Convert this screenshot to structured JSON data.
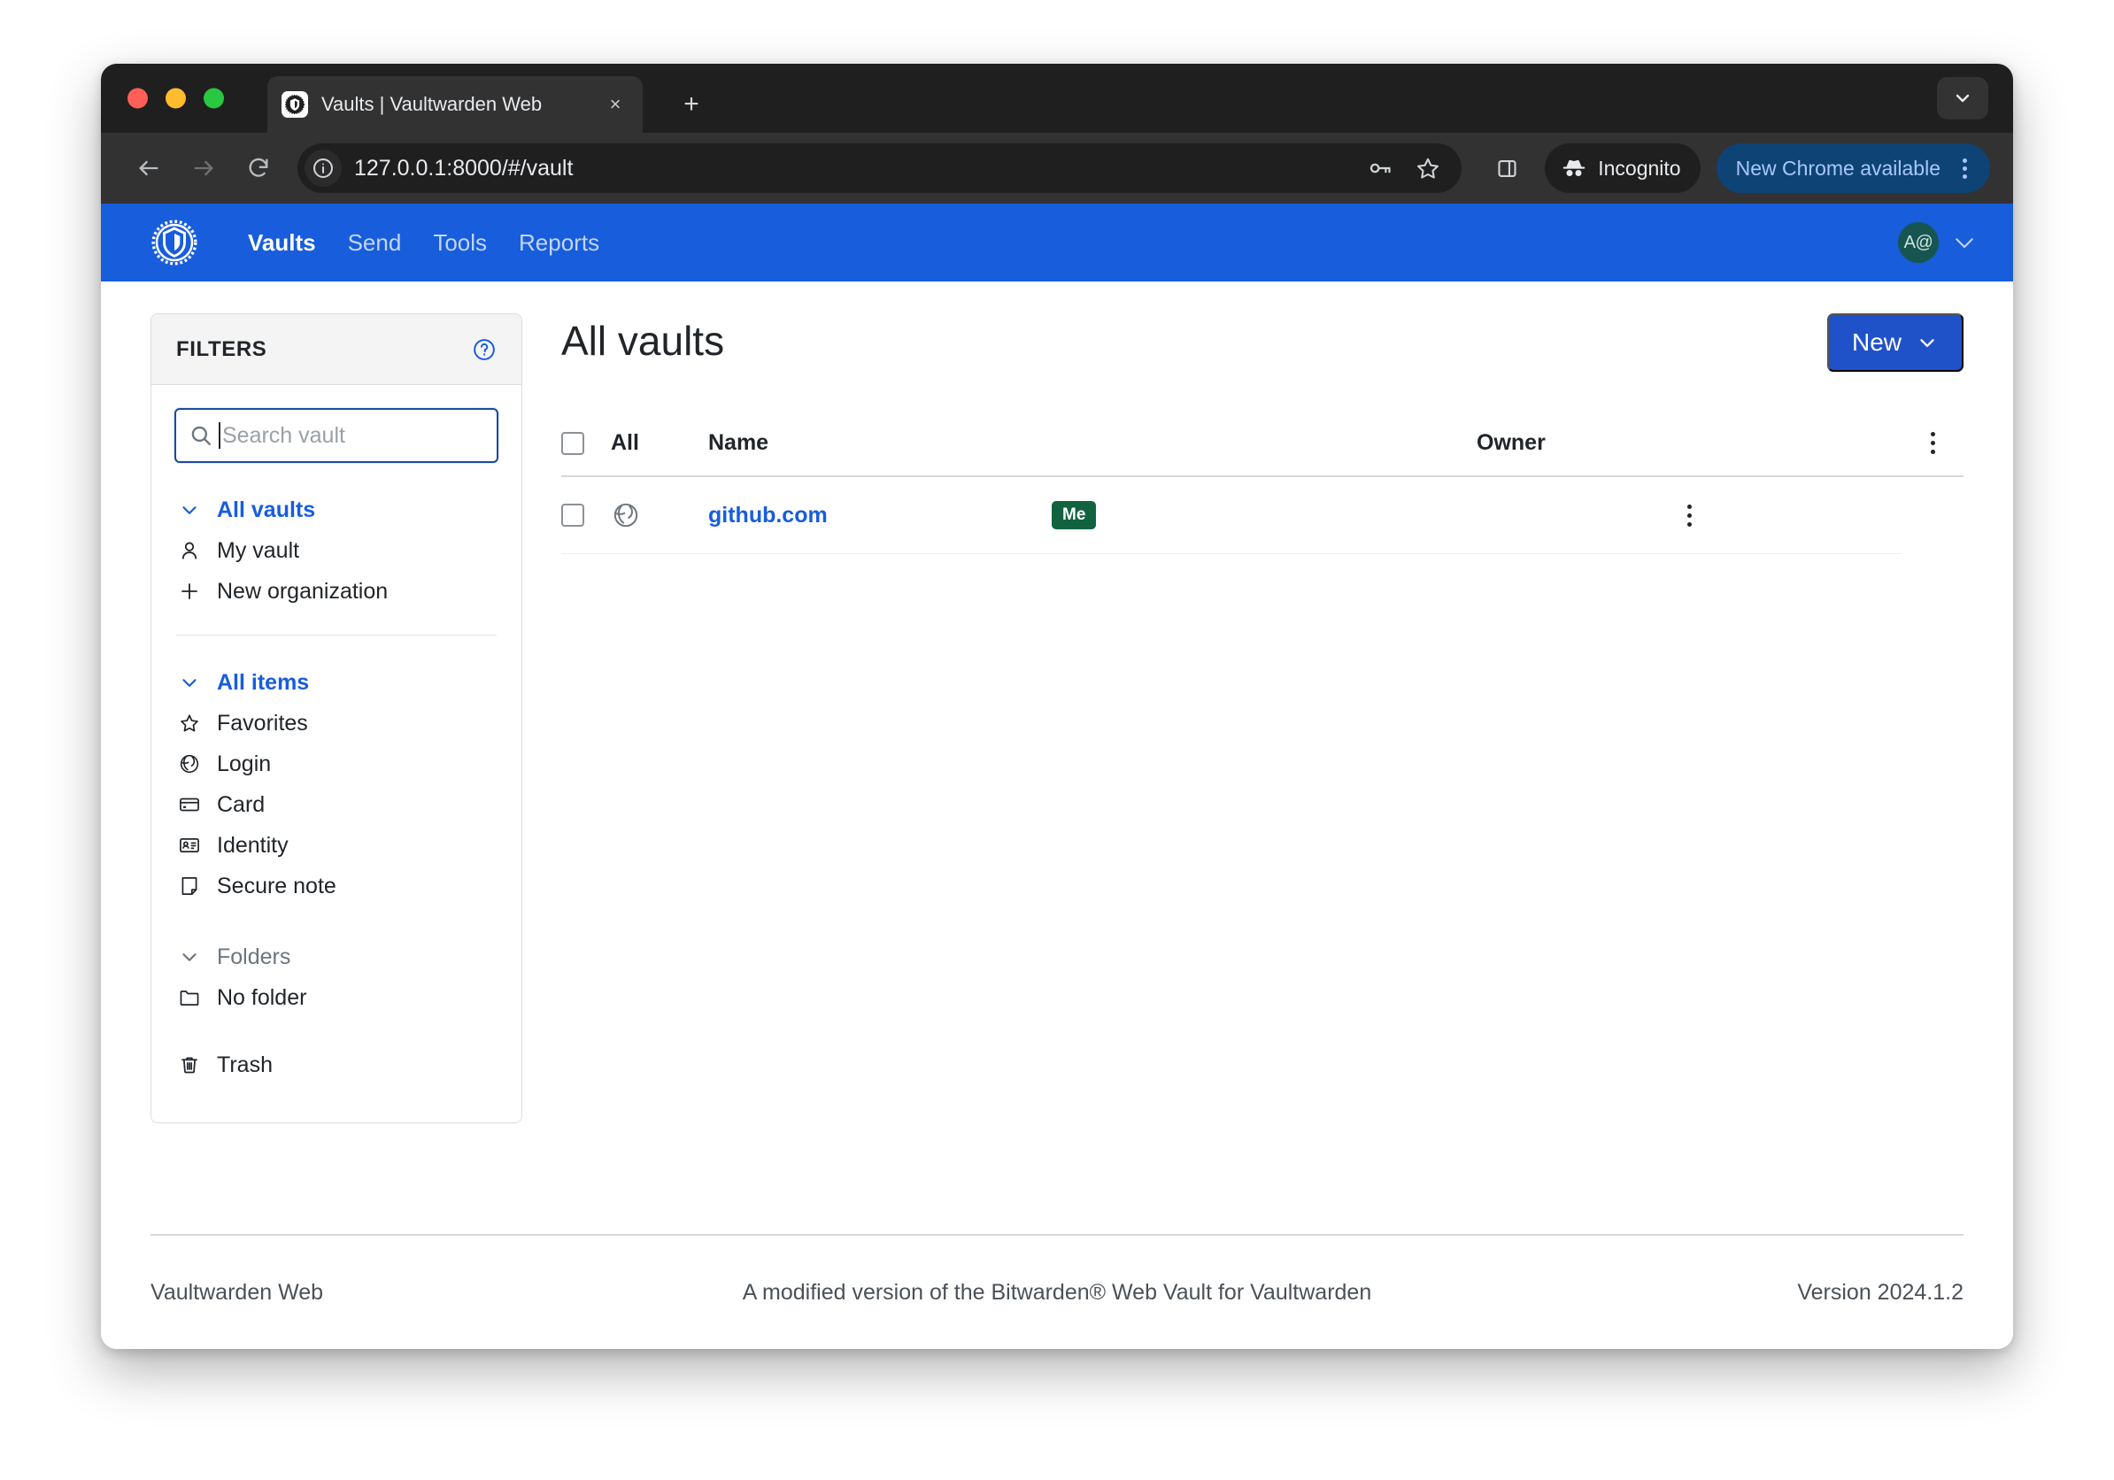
{
  "browser": {
    "tab": {
      "title": "Vaults | Vaultwarden Web",
      "favicon": "vaultwarden-shield-icon",
      "close": "×"
    },
    "new_tab": "+",
    "tab_search": "chevron-down-icon",
    "nav": {
      "back": "back-arrow-icon",
      "forward": "forward-arrow-icon",
      "reload": "reload-icon"
    },
    "omnibox": {
      "site_info": "info-circle-icon",
      "url": "127.0.0.1:8000/#/vault",
      "password_manager": "key-icon",
      "bookmark": "star-icon"
    },
    "side_panel": "side-panel-icon",
    "incognito": {
      "label": "Incognito",
      "icon": "incognito-hat-icon"
    },
    "update": {
      "label": "New Chrome available",
      "menu": "kebab-menu-icon"
    },
    "window_controls": {
      "close": "close-dot",
      "minimize": "minimize-dot",
      "zoom": "zoom-dot"
    }
  },
  "appnav": {
    "logo": "vaultwarden-logo",
    "links": [
      {
        "label": "Vaults",
        "active": true
      },
      {
        "label": "Send",
        "active": false
      },
      {
        "label": "Tools",
        "active": false
      },
      {
        "label": "Reports",
        "active": false
      }
    ],
    "account": {
      "initials": "A@",
      "chevron": "chevron-down-icon"
    }
  },
  "filters": {
    "title": "FILTERS",
    "help": "help-circle-icon",
    "search": {
      "placeholder": "Search vault",
      "value": "",
      "icon": "search-icon"
    },
    "vaults_group": {
      "header": {
        "label": "All vaults",
        "icon": "chevron-down-icon"
      },
      "items": [
        {
          "label": "My vault",
          "icon": "user-icon"
        },
        {
          "label": "New organization",
          "icon": "plus-icon"
        }
      ]
    },
    "items_group": {
      "header": {
        "label": "All items",
        "icon": "chevron-down-icon"
      },
      "items": [
        {
          "label": "Favorites",
          "icon": "star-icon"
        },
        {
          "label": "Login",
          "icon": "globe-icon"
        },
        {
          "label": "Card",
          "icon": "card-icon"
        },
        {
          "label": "Identity",
          "icon": "identity-icon"
        },
        {
          "label": "Secure note",
          "icon": "note-icon"
        }
      ]
    },
    "folders_group": {
      "header": {
        "label": "Folders",
        "icon": "chevron-down-icon"
      },
      "items": [
        {
          "label": "No folder",
          "icon": "folder-icon"
        }
      ]
    },
    "trash": {
      "label": "Trash",
      "icon": "trash-icon"
    }
  },
  "main": {
    "page_title": "All vaults",
    "new_button": {
      "label": "New",
      "icon": "chevron-down-icon"
    },
    "table": {
      "headers": {
        "all": "All",
        "name": "Name",
        "owner": "Owner",
        "menu": "kebab-menu-icon"
      },
      "rows": [
        {
          "checked": false,
          "icon": "globe-icon",
          "name": "github.com",
          "owner": "Me",
          "menu": "kebab-menu-icon"
        }
      ]
    }
  },
  "footer": {
    "left": "Vaultwarden Web",
    "center": "A modified version of the Bitwarden® Web Vault for Vaultwarden",
    "right": "Version 2024.1.2"
  },
  "colors": {
    "brand_blue": "#175ddc",
    "button_blue": "#1f52c9",
    "owner_green": "#11633f",
    "avatar_teal": "#175650",
    "chrome_dark": "#1f1f1f",
    "toolbar_dark": "#323232",
    "update_blue": "#0e4376"
  }
}
